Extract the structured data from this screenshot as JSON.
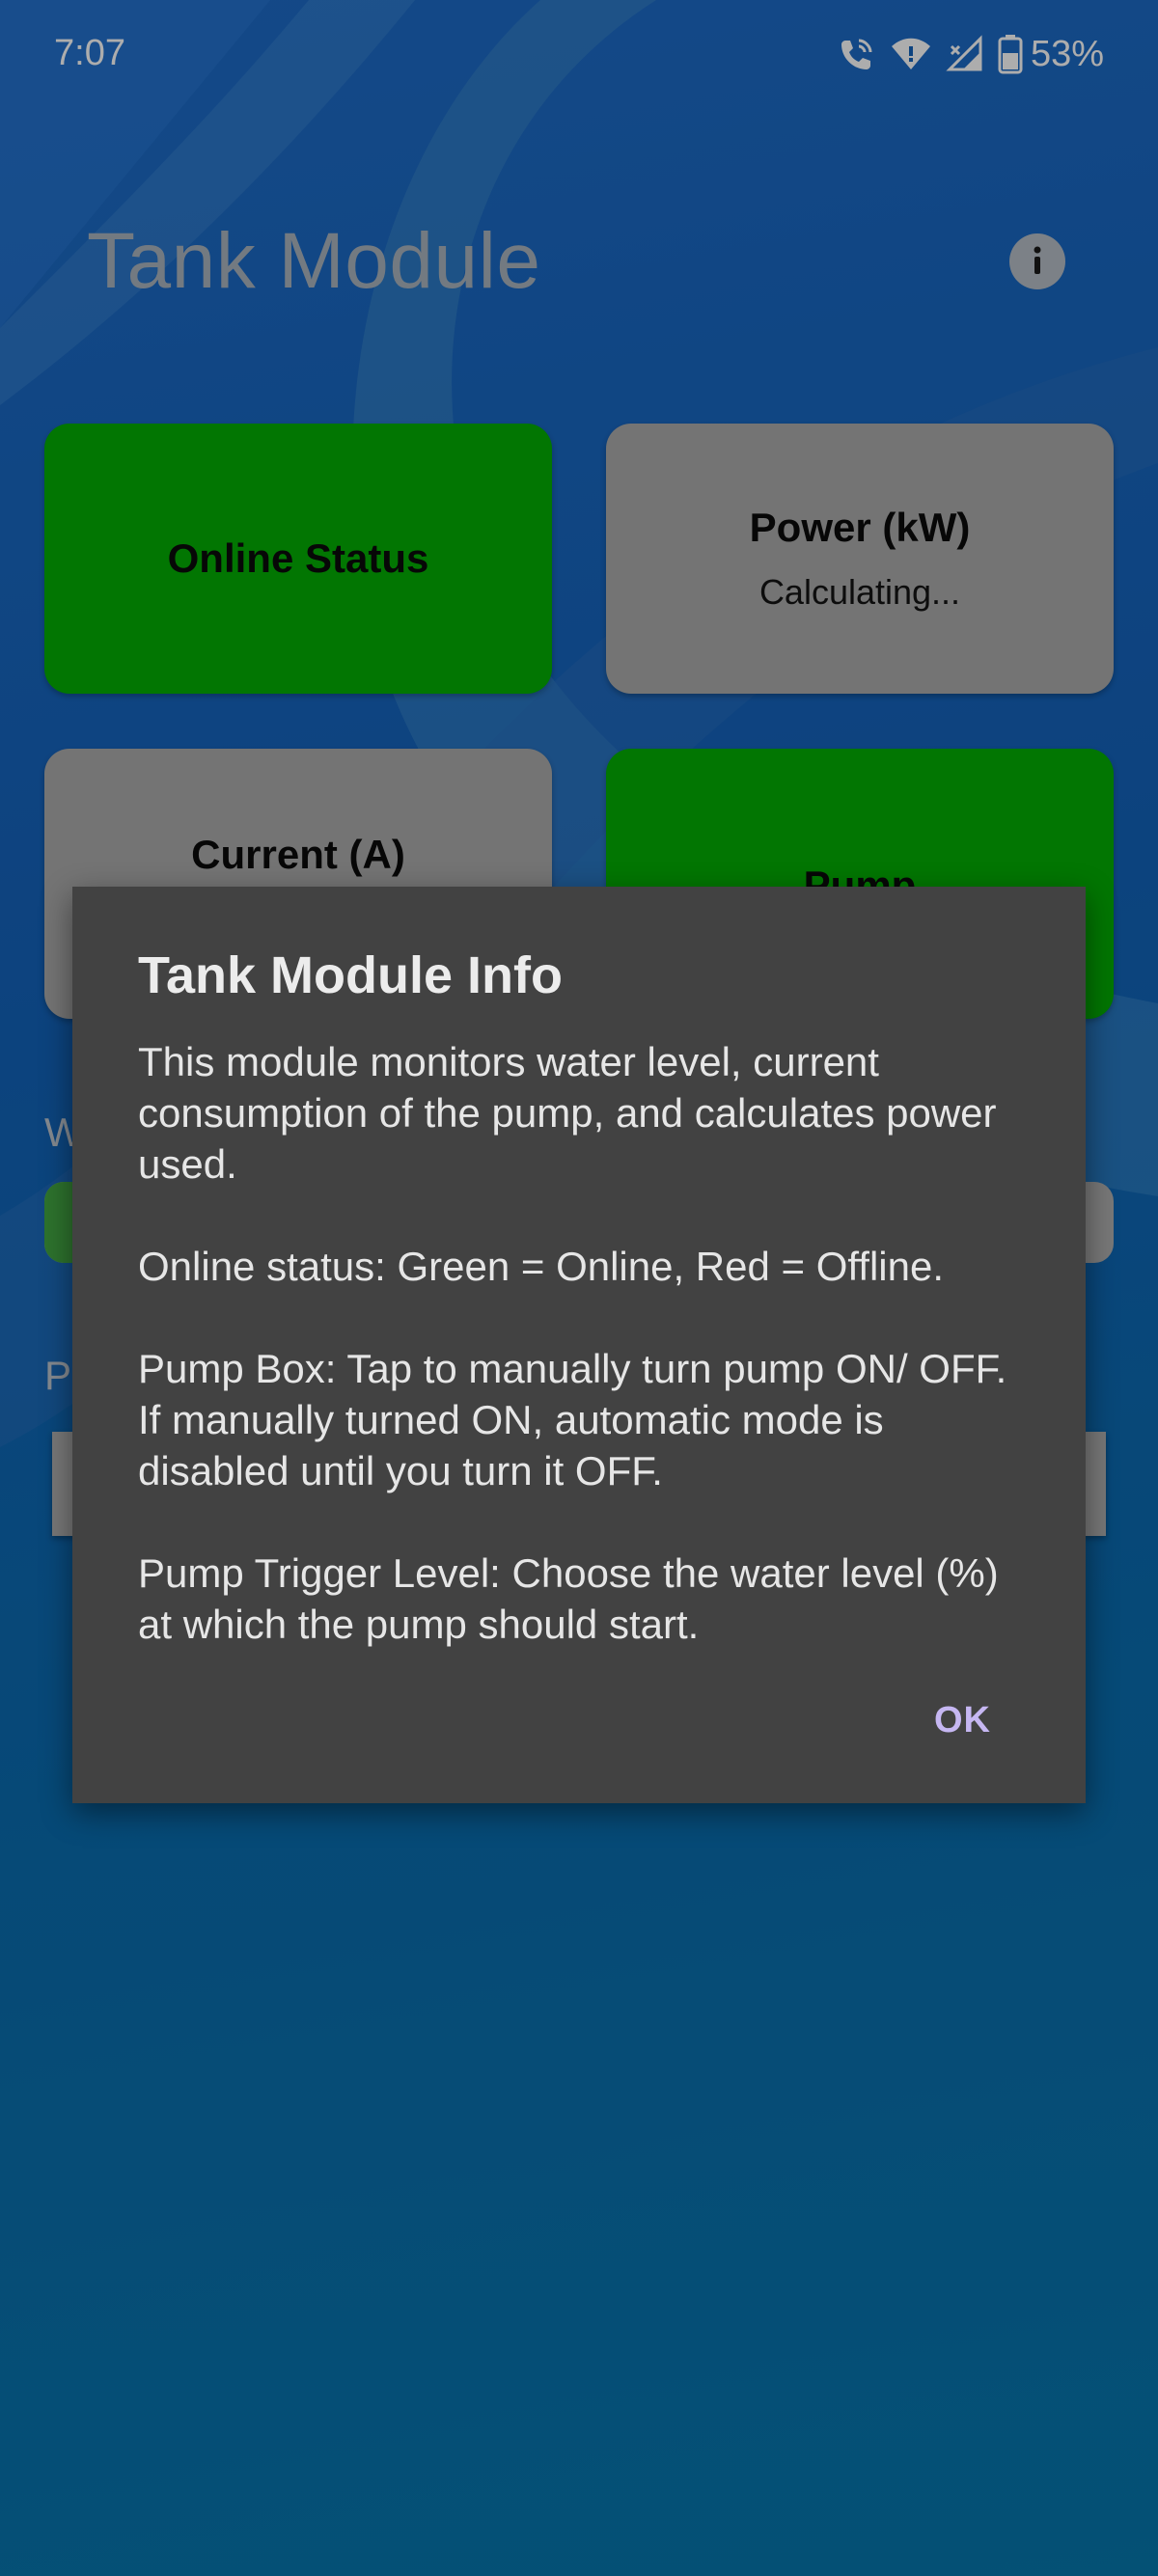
{
  "status_bar": {
    "time": "7:07",
    "battery": "53%",
    "icons": [
      "wifi-call-icon",
      "wifi-icon",
      "cell-signal-icon",
      "battery-icon"
    ]
  },
  "header": {
    "title": "Tank Module",
    "info_icon": "info-icon"
  },
  "cards": {
    "online": {
      "title": "Online Status",
      "color": "#03ae03"
    },
    "power": {
      "title": "Power (kW)",
      "value": "Calculating...",
      "color": "#ababab"
    },
    "current": {
      "title": "Current (A)",
      "color": "#ababab"
    },
    "pump": {
      "title": "Pump",
      "color": "#03ae03"
    }
  },
  "background_labels": {
    "water_label_fragment": "W",
    "trigger_label_fragment": "P"
  },
  "water_level": {
    "fill_fraction": 0.04
  },
  "dialog": {
    "title": "Tank Module Info",
    "paragraphs": [
      "This module monitors water level, current consumption of the pump, and calculates power used.",
      "Online status: Green = Online, Red = Offline.",
      "Pump Box: Tap to manually turn pump ON/ OFF. If manually turned ON, automatic mode is disabled until you turn it OFF.",
      "Pump Trigger Level: Choose the water level (%) at which the pump should start."
    ],
    "ok_label": "OK"
  },
  "colors": {
    "accent": "#c6b7f2",
    "dialog_bg": "#424242",
    "online_green": "#03ae03"
  }
}
